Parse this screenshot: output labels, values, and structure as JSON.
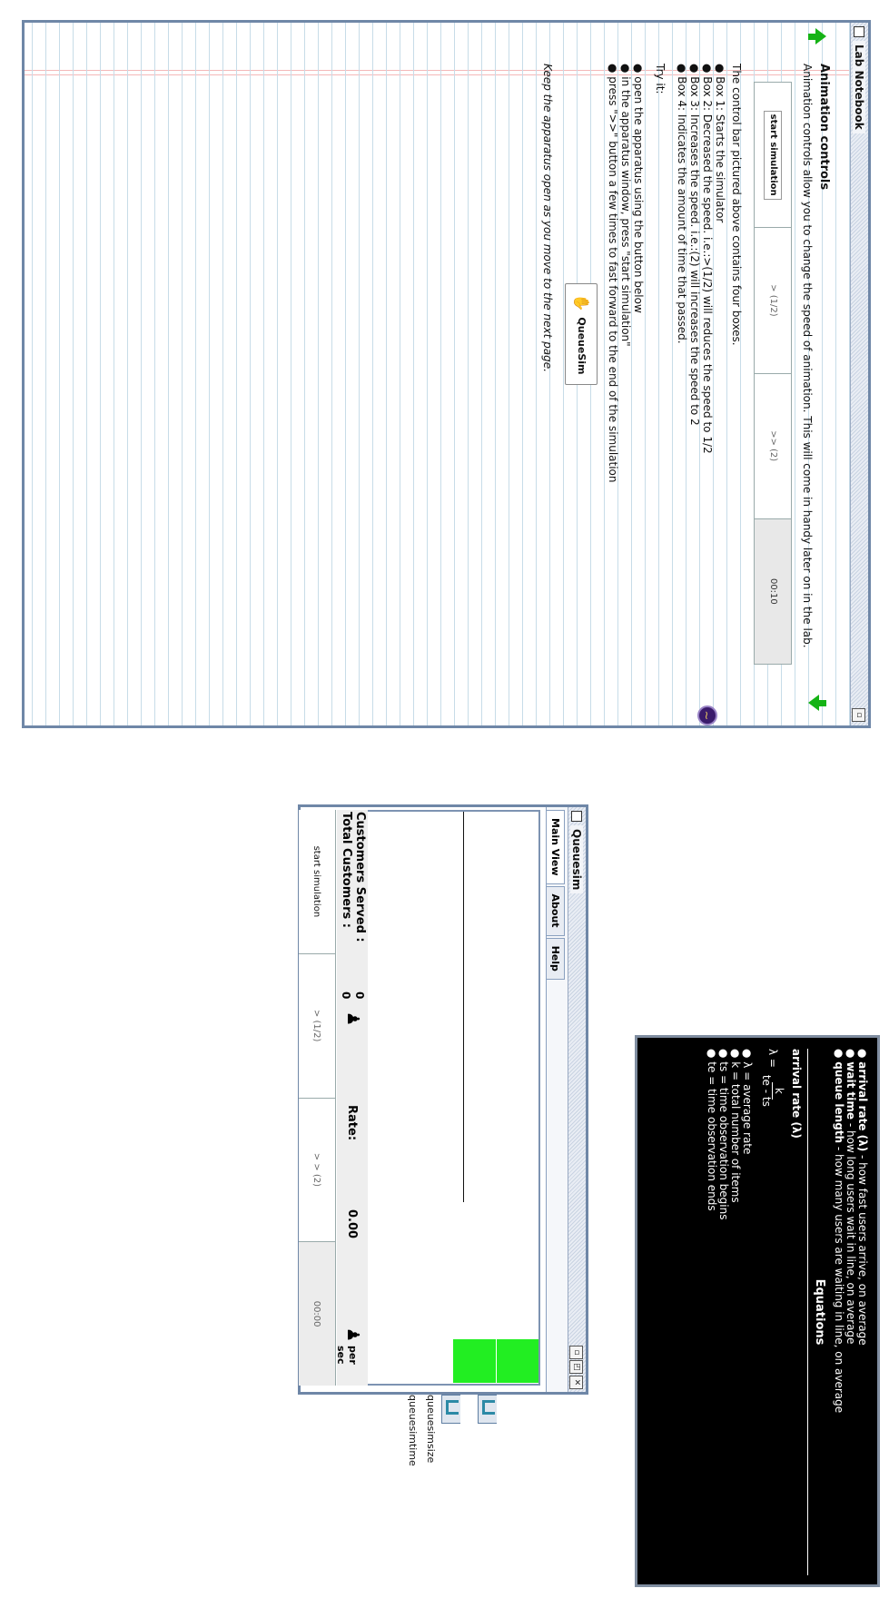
{
  "notebook": {
    "title": "Lab Notebook",
    "heading": "Animation controls",
    "intro": "Animation controls allow you to change the speed of animation. This will come in handy later on in the lab.",
    "control_bar": [
      "start simulation",
      "> (1/2)",
      ">> (2)",
      "00:10"
    ],
    "desc": "The control bar pictured above contains four boxes.",
    "boxes": [
      "Box 1: Starts the simulator",
      "Box 2: Decreased the speed. i.e.:>(1/2) will reduces the speed to 1/2",
      "Box 3: Increases the speed. i.e.:(2) will increases the speed to 2",
      "Box 4: Indicates the amount of time that passed."
    ],
    "try_it": "Try it:",
    "steps": [
      "open the apparatus using the button below",
      "in the apparatus window, press \"start simulation\"",
      "press \">>\" button a few times to fast forward to the end of the simulation"
    ],
    "queuesim_button": "QueueSim",
    "footer": "Keep the apparatus open as you move to the next page."
  },
  "queuesim": {
    "title": "Queuesim",
    "tabs": [
      "Main View",
      "About",
      "Help"
    ],
    "stats": {
      "served_label": "Customers Served :",
      "served_value": "0",
      "total_label": "Total Customers  :",
      "total_value": "0",
      "rate_label": "Rate:",
      "rate_value": "0.00",
      "unit": "per sec"
    },
    "controls": [
      "start simulation",
      "> (1/2)",
      "> > (2)",
      "00:00"
    ],
    "side_tabs": [
      "queuesimsize",
      "queuesimtime"
    ]
  },
  "equations": {
    "bullets": [
      {
        "term": "arrival rate (λ)",
        "desc": " - how fast users arrive, on average"
      },
      {
        "term": "wait time",
        "desc": " - how long users wait in line, on average"
      },
      {
        "term": "queue length",
        "desc": " - how many users are waiting in line, on average"
      }
    ],
    "title": "Equations",
    "sub": "arrival rate (λ)",
    "formula_lhs": "λ =",
    "formula_num": "k",
    "formula_den": "te - ts",
    "defs": [
      "λ = average rate",
      "k = total number of items",
      "ts = time observation begins",
      "te = time observation ends"
    ]
  },
  "colors": {
    "window_border": "#6f87a7",
    "green": "#22ee22",
    "arrow_green": "#15b315"
  }
}
